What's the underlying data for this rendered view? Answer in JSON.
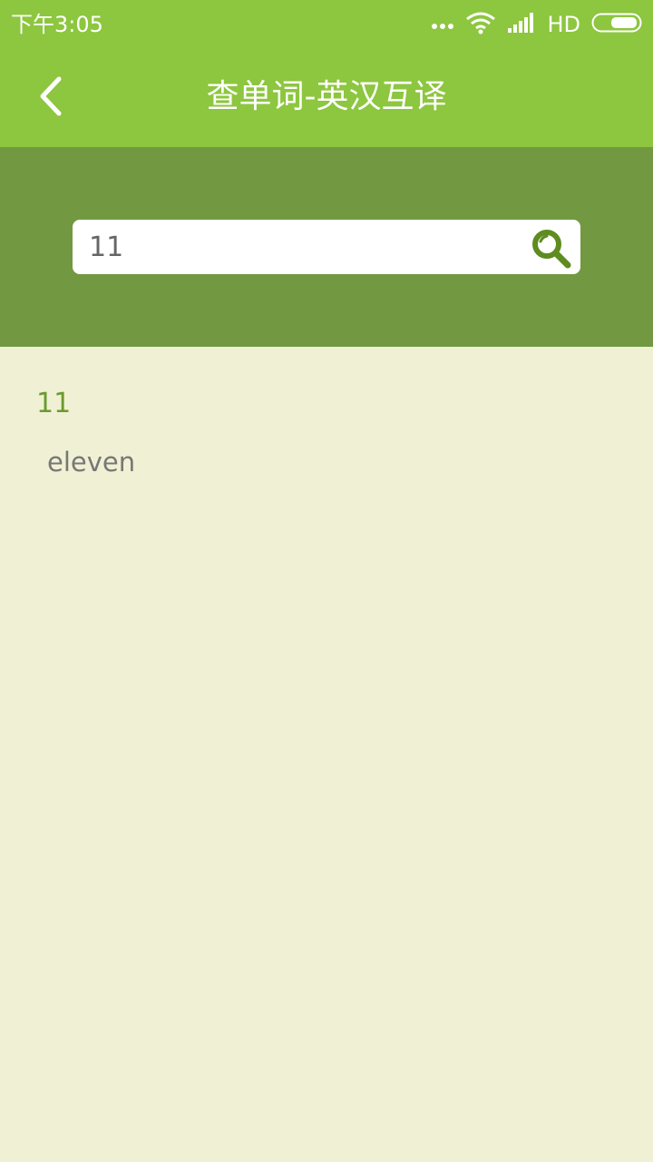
{
  "status_bar": {
    "time": "下午3:05",
    "network": "HD",
    "icons": [
      "more-dots-icon",
      "wifi-icon",
      "signal-icon",
      "battery-icon"
    ]
  },
  "header": {
    "title": "查单词-英汉互译",
    "back_icon": "chevron-left-icon"
  },
  "search": {
    "value": "11",
    "button_icon": "search-icon"
  },
  "result": {
    "word": "11",
    "translation": "eleven"
  },
  "colors": {
    "header_green": "#8dc63f",
    "panel_green": "#729941",
    "background": "#f0f1d4",
    "word_green": "#6b9a30",
    "icon_green": "#5e8c1f",
    "translation_gray": "#777777"
  }
}
